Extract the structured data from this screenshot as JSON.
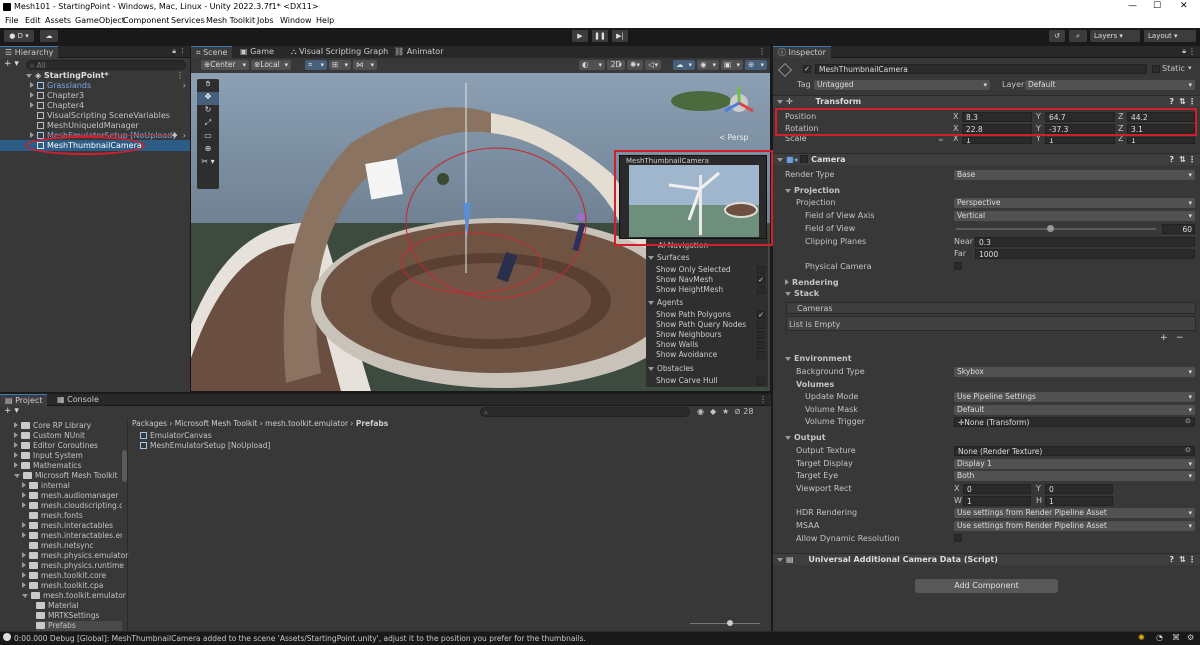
{
  "window": {
    "title": "Mesh101 - StartingPoint - Windows, Mac, Linux - Unity 2022.3.7f1* <DX11>"
  },
  "menu": [
    "File",
    "Edit",
    "Assets",
    "GameObject",
    "Component",
    "Services",
    "Mesh Toolkit",
    "Jobs",
    "Window",
    "Help"
  ],
  "toolbar": {
    "account": "D",
    "layers": "Layers",
    "layout": "Layout"
  },
  "hierarchy": {
    "tab": "Hierarchy",
    "search_placeholder": "All",
    "items": [
      {
        "label": "StartingPoint*",
        "depth": 0,
        "kind": "scene"
      },
      {
        "label": "Grasslands",
        "depth": 1,
        "kind": "prefab"
      },
      {
        "label": "Chapter3",
        "depth": 1,
        "kind": "object"
      },
      {
        "label": "Chapter4",
        "depth": 1,
        "kind": "object"
      },
      {
        "label": "VisualScripting SceneVariables",
        "depth": 1,
        "kind": "object"
      },
      {
        "label": "MeshUniqueIdManager",
        "depth": 1,
        "kind": "object"
      },
      {
        "label": "MeshEmulatorSetup [NoUpload]",
        "depth": 1,
        "kind": "prefab"
      },
      {
        "label": "MeshThumbnailCamera",
        "depth": 1,
        "kind": "selected"
      }
    ]
  },
  "scene_tabs": [
    "Scene",
    "Game",
    "Visual Scripting Graph",
    "Animator"
  ],
  "scene_toolbar": {
    "pivot": "Center",
    "space": "Local",
    "mode_2d": "2D"
  },
  "gizmo_label": "< Persp",
  "camera_preview_title": "MeshThumbnailCamera",
  "ai_nav": {
    "title": "AI Navigation",
    "groups": [
      {
        "name": "Surfaces",
        "rows": [
          {
            "label": "Show Only Selected",
            "checked": false
          },
          {
            "label": "Show NavMesh",
            "checked": true
          },
          {
            "label": "Show HeightMesh",
            "checked": false
          }
        ]
      },
      {
        "name": "Agents",
        "rows": [
          {
            "label": "Show Path Polygons",
            "checked": true
          },
          {
            "label": "Show Path Query Nodes",
            "checked": false
          },
          {
            "label": "Show Neighbours",
            "checked": false
          },
          {
            "label": "Show Walls",
            "checked": false
          },
          {
            "label": "Show Avoidance",
            "checked": false
          }
        ]
      },
      {
        "name": "Obstacles",
        "rows": [
          {
            "label": "Show Carve Hull",
            "checked": false
          }
        ]
      }
    ]
  },
  "project": {
    "tabs": [
      "Project",
      "Console"
    ],
    "breadcrumb": [
      "Packages",
      "Microsoft Mesh Toolkit",
      "mesh.toolkit.emulator",
      "Prefabs"
    ],
    "hidden_count": "28",
    "tree": [
      {
        "label": "Core RP Library",
        "depth": 0
      },
      {
        "label": "Custom NUnit",
        "depth": 0
      },
      {
        "label": "Editor Coroutines",
        "depth": 0
      },
      {
        "label": "Input System",
        "depth": 0
      },
      {
        "label": "Mathematics",
        "depth": 0
      },
      {
        "label": "Microsoft Mesh Toolkit",
        "depth": 0,
        "open": true
      },
      {
        "label": "internal",
        "depth": 1
      },
      {
        "label": "mesh.audiomanager",
        "depth": 1
      },
      {
        "label": "mesh.cloudscripting.clie",
        "depth": 1
      },
      {
        "label": "mesh.fonts",
        "depth": 1
      },
      {
        "label": "mesh.interactables",
        "depth": 1
      },
      {
        "label": "mesh.interactables.emu",
        "depth": 1
      },
      {
        "label": "mesh.netsync",
        "depth": 1
      },
      {
        "label": "mesh.physics.emulator",
        "depth": 1
      },
      {
        "label": "mesh.physics.runtime",
        "depth": 1
      },
      {
        "label": "mesh.toolkit.core",
        "depth": 1
      },
      {
        "label": "mesh.toolkit.cpa",
        "depth": 1
      },
      {
        "label": "mesh.toolkit.emulator",
        "depth": 1,
        "open": true
      },
      {
        "label": "Material",
        "depth": 2
      },
      {
        "label": "MRTKSettings",
        "depth": 2
      },
      {
        "label": "Prefabs",
        "depth": 2
      }
    ],
    "assets": [
      "EmulatorCanvas",
      "MeshEmulatorSetup [NoUpload]"
    ]
  },
  "inspector": {
    "tab": "Inspector",
    "object_name": "MeshThumbnailCamera",
    "static_label": "Static",
    "tag_label": "Tag",
    "tag_value": "Untagged",
    "layer_label": "Layer",
    "layer_value": "Default",
    "transform": {
      "title": "Transform",
      "position_label": "Position",
      "position": {
        "x": "8.3",
        "y": "64.7",
        "z": "44.2"
      },
      "rotation_label": "Rotation",
      "rotation": {
        "x": "22.8",
        "y": "-37.3",
        "z": "3.1"
      },
      "scale_label": "Scale",
      "scale": {
        "x": "1",
        "y": "1",
        "z": "1"
      }
    },
    "camera": {
      "title": "Camera",
      "render_type_label": "Render Type",
      "render_type": "Base",
      "projection_label": "Projection",
      "projection_sub_label": "Projection",
      "projection": "Perspective",
      "fov_axis_label": "Field of View Axis",
      "fov_axis": "Vertical",
      "fov_label": "Field of View",
      "fov": "60",
      "fov_fraction": 0.47,
      "clipping_label": "Clipping Planes",
      "near_label": "Near",
      "near": "0.3",
      "far_label": "Far",
      "far": "1000",
      "physical_label": "Physical Camera",
      "rendering_label": "Rendering",
      "stack_label": "Stack",
      "cameras_label": "Cameras",
      "list_empty": "List is Empty",
      "environment_label": "Environment",
      "bg_type_label": "Background Type",
      "bg_type": "Skybox",
      "volumes_label": "Volumes",
      "update_mode_label": "Update Mode",
      "update_mode": "Use Pipeline Settings",
      "volume_mask_label": "Volume Mask",
      "volume_mask": "Default",
      "volume_trigger_label": "Volume Trigger",
      "volume_trigger": "None (Transform)",
      "output_label": "Output",
      "output_texture_label": "Output Texture",
      "output_texture": "None (Render Texture)",
      "target_display_label": "Target Display",
      "target_display": "Display 1",
      "target_eye_label": "Target Eye",
      "target_eye": "Both",
      "viewport_label": "Viewport Rect",
      "vp_x": "0",
      "vp_y": "0",
      "vp_w": "1",
      "vp_h": "1",
      "hdr_label": "HDR Rendering",
      "hdr": "Use settings from Render Pipeline Asset",
      "msaa_label": "MSAA",
      "msaa": "Use settings from Render Pipeline Asset",
      "dyn_res_label": "Allow Dynamic Resolution"
    },
    "uacd_title": "Universal Additional Camera Data (Script)",
    "add_component": "Add Component"
  },
  "status_bar": "0:00.000 Debug [Global]: MeshThumbnailCamera added to the scene 'Assets/StartingPoint.unity', adjust it to the position you prefer for the thumbnails.",
  "colors": {
    "accent": "#3a79bb",
    "highlight_red": "#d21f2c",
    "selection": "#2c5d87"
  }
}
